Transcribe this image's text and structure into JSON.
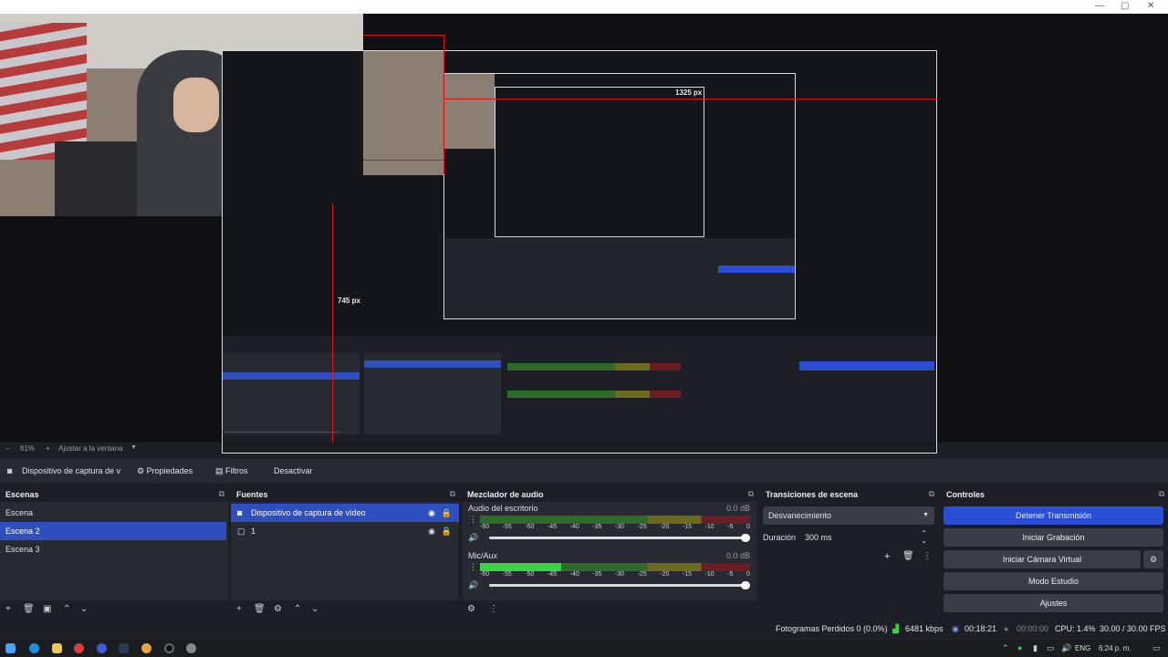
{
  "window": {
    "min": "—",
    "max": "▢",
    "close": "✕"
  },
  "preview": {
    "inner_width_label": "1325 px",
    "inner_height_label": "745 px",
    "inner_zoom": "61%",
    "inner_fit": "Ajustar a la ventana"
  },
  "zoom": {
    "value": "61%",
    "plus": "+",
    "fit_label": "Ajustar a la ventana"
  },
  "source_bar": {
    "selected_source": "Dispositivo de captura de v",
    "properties": "Propiedades",
    "filters": "Filtros",
    "deactivate": "Desactivar"
  },
  "scenes": {
    "title": "Escenas",
    "items": [
      "Escena",
      "Escena 2",
      "Escena 3"
    ],
    "selected": 1
  },
  "sources": {
    "title": "Fuentes",
    "items": [
      "Dispositivo de captura de vídeo",
      "1"
    ]
  },
  "mixer": {
    "title": "Mezclador de audio",
    "channels": [
      {
        "name": "Audio del escritorio",
        "db": "0.0 dB",
        "level": 0.0
      },
      {
        "name": "Mic/Aux",
        "db": "0.0 dB",
        "level": 0.3
      }
    ],
    "ticks": [
      "-60",
      "-55",
      "-50",
      "-45",
      "-40",
      "-35",
      "-30",
      "-25",
      "-20",
      "-15",
      "-10",
      "-5",
      "0"
    ]
  },
  "transitions": {
    "title": "Transiciones de escena",
    "selected": "Desvanecimiento",
    "duration_label": "Duración",
    "duration_value": "300 ms"
  },
  "controls": {
    "title": "Controles",
    "stop_stream": "Detener Transmisión",
    "start_recording": "Iniciar Grabación",
    "virtual_cam": "Iniciar Cámara Virtual",
    "studio_mode": "Modo Estudio",
    "settings": "Ajustes"
  },
  "status": {
    "dropped": "Fotogramas Perdidos 0 (0.0%)",
    "bitrate": "6481 kbps",
    "stream_time": "00:18:21",
    "rec_time": "00:00:00",
    "cpu": "CPU: 1.4%",
    "fps": "30.00 / 30.00 FPS"
  },
  "taskbar": {
    "lang": "ENG",
    "time": "6:24 p. m."
  },
  "colors": {
    "accent": "#2b4ed6",
    "selection": "#2e4fbd",
    "red_guide": "#e01010"
  }
}
